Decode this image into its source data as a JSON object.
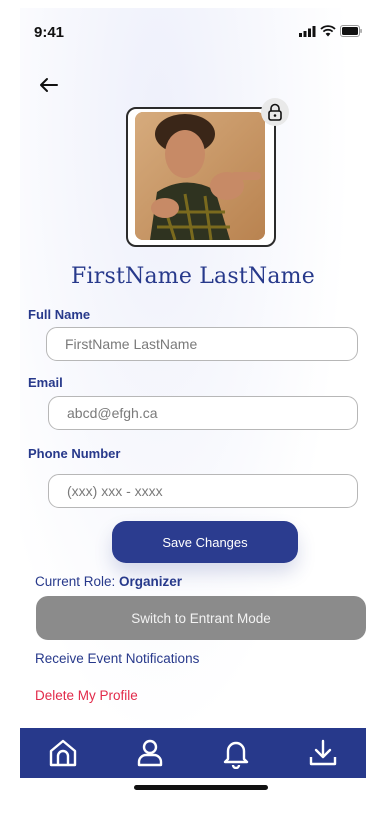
{
  "status_bar": {
    "time": "9:41"
  },
  "profile": {
    "display_name": "FirstName  LastName"
  },
  "form": {
    "full_name": {
      "label": "Full Name",
      "placeholder": "FirstName LastName"
    },
    "email": {
      "label": "Email",
      "placeholder": "abcd@efgh.ca"
    },
    "phone": {
      "label": "Phone Number",
      "placeholder": "(xxx) xxx - xxxx"
    },
    "save_label": "Save Changes"
  },
  "role": {
    "prefix": "Current Role: ",
    "value": "Organizer",
    "switch_label": "Switch to Entrant Mode"
  },
  "links": {
    "notifications": "Receive Event Notifications",
    "delete": "Delete My Profile"
  },
  "tabs": [
    "home-icon",
    "profile-icon",
    "bell-icon",
    "download-icon"
  ],
  "colors": {
    "primary": "#27398b",
    "danger": "#e22a4a",
    "disabled_button": "#8b8b8b"
  }
}
